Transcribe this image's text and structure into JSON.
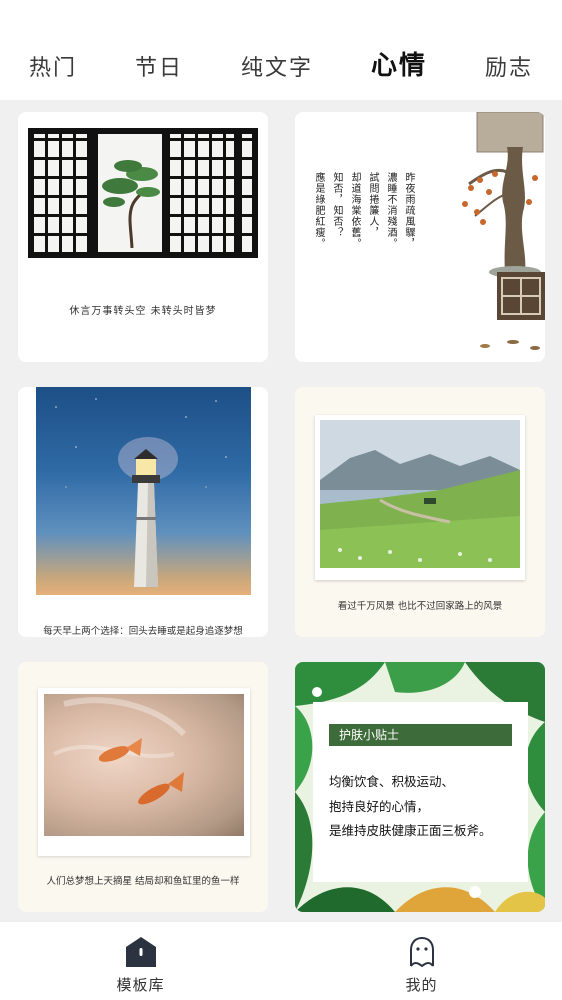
{
  "tabs": [
    {
      "label": "热门",
      "active": false
    },
    {
      "label": "节日",
      "active": false
    },
    {
      "label": "纯文字",
      "active": false
    },
    {
      "label": "心情",
      "active": true
    },
    {
      "label": "励志",
      "active": false
    }
  ],
  "cards": [
    {
      "caption": "休言万事转头空 未转头时皆梦"
    },
    {
      "poem_columns": [
        "昨夜雨疏風驟，",
        "濃睡不消殘酒。",
        "試問捲簾人，",
        "却道海棠依舊。",
        "知否，知否？",
        "應是綠肥紅瘦。"
      ]
    },
    {
      "caption": "每天早上两个选择：回头去睡或是起身追逐梦想"
    },
    {
      "caption": "看过千万风景  也比不过回家路上的风景"
    },
    {
      "caption": "人们总梦想上天摘星  结局却和鱼缸里的鱼一样"
    },
    {
      "title": "护肤小贴士",
      "lines": [
        "均衡饮食、积极运动、",
        "抱持良好的心情，",
        "是维持皮肤健康正面三板斧。"
      ]
    }
  ],
  "bottom_nav": {
    "templates": {
      "label": "模板库",
      "icon": "home-icon",
      "active": true
    },
    "mine": {
      "label": "我的",
      "icon": "profile-icon",
      "active": false
    }
  },
  "colors": {
    "background": "#f0f0f0",
    "tip_title": "#3e6b3a",
    "leaf_green": "#2f8d3e"
  }
}
